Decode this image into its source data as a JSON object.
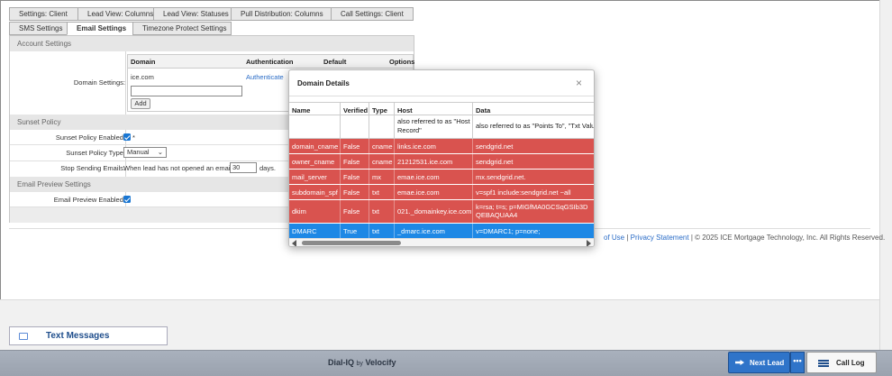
{
  "tabs_row1": [
    "Settings: Client",
    "Lead View: Columns",
    "Lead View: Statuses",
    "Pull Distribution: Columns",
    "Call Settings: Client"
  ],
  "tabs_row2": [
    "SMS Settings",
    "Email Settings",
    "Timezone Protect Settings"
  ],
  "account": {
    "header": "Account Settings",
    "domain_label": "Domain Settings:",
    "columns": [
      "Domain",
      "Authentication",
      "Default",
      "Options"
    ],
    "domain_value": "ice.com",
    "auth_link": "Authenticate",
    "new_domain_value": "",
    "add_label": "Add"
  },
  "sunset": {
    "header": "Sunset Policy",
    "enabled_label": "Sunset Policy Enabled:",
    "required_mark": "*",
    "type_label": "Sunset Policy Type:",
    "type_value": "Manual",
    "stop_label": "Stop Sending Emails:",
    "stop_text_pre": "When lead has not opened an email in",
    "stop_days": "30",
    "stop_text_post": "days."
  },
  "preview": {
    "header": "Email Preview Settings",
    "enabled_label": "Email Preview Enabled:"
  },
  "footer": {
    "link1": "of Use",
    "sep": "|",
    "link2": "Privacy Statement",
    "copyright": "| © 2025 ICE Mortgage Technology, Inc. All Rights Reserved."
  },
  "modal": {
    "title": "Domain Details",
    "close": "×",
    "columns": [
      "Name",
      "Verified",
      "Type",
      "Host",
      "Data"
    ],
    "desc_host": "also referred to as \"Host Record\"",
    "desc_data": "also referred to as \"Points To\", \"Txt Value",
    "rows": [
      {
        "name": "domain_cname",
        "verified": "False",
        "type": "cname",
        "host": "links.ice.com",
        "data": "sendgrid.net",
        "status": "error"
      },
      {
        "name": "owner_cname",
        "verified": "False",
        "type": "cname",
        "host": "21212531.ice.com",
        "data": "sendgrid.net",
        "status": "error"
      },
      {
        "name": "mail_server",
        "verified": "False",
        "type": "mx",
        "host": "emae.ice.com",
        "data": "mx.sendgrid.net.",
        "status": "error"
      },
      {
        "name": "subdomain_spf",
        "verified": "False",
        "type": "txt",
        "host": "emae.ice.com",
        "data": "v=spf1 include:sendgrid.net ~all",
        "status": "error"
      },
      {
        "name": "dkim",
        "verified": "False",
        "type": "txt",
        "host": "021._domainkey.ice.com",
        "data": "k=rsa; t=s; p=MIGfMA0GCSqGSIb3DQEBAQUAA4",
        "status": "error"
      },
      {
        "name": "DMARC",
        "verified": "True",
        "type": "txt",
        "host": "_dmarc.ice.com",
        "data": "v=DMARC1; p=none;",
        "status": "ok"
      }
    ]
  },
  "text_messages": "Text Messages",
  "brand": {
    "name": "Dial-IQ",
    "by": "by",
    "vendor": "Velocify"
  },
  "next_lead": "Next Lead",
  "more": "•••",
  "call_log": "Call Log",
  "colors": {
    "error_row": "#d9534f",
    "ok_row": "#1e88e5",
    "primary_button": "#2f74c9",
    "link": "#2a6cc7"
  }
}
